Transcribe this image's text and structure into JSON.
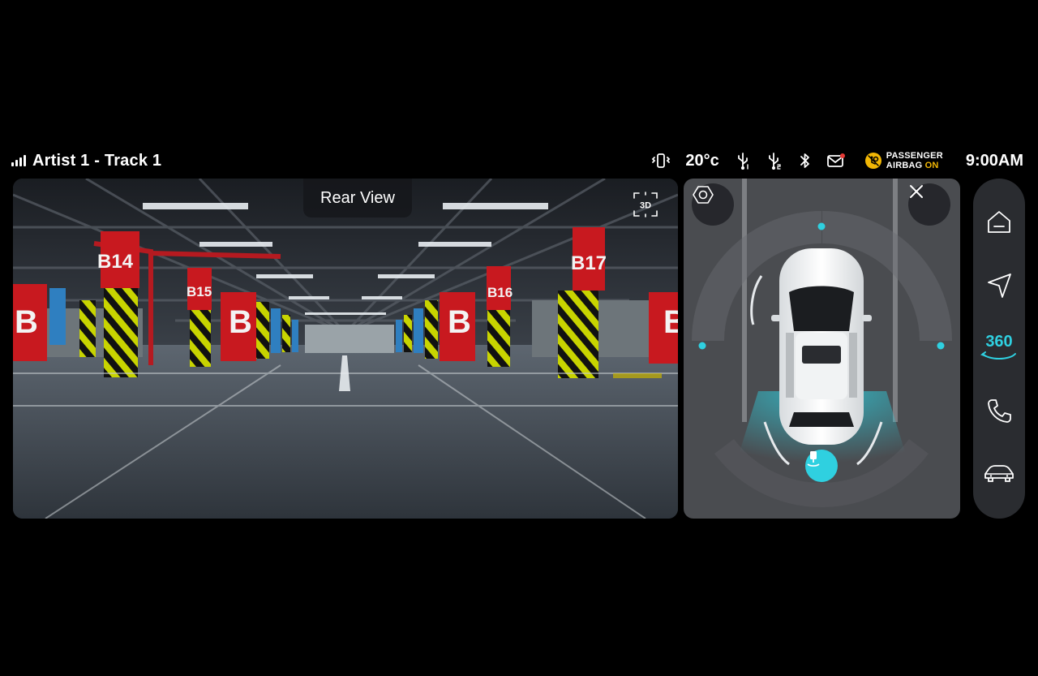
{
  "media": {
    "now_playing": "Artist 1 - Track 1"
  },
  "status": {
    "temperature": "20°c",
    "airbag_line1": "PASSENGER",
    "airbag_line2": "AIRBAG",
    "airbag_state": "ON",
    "clock": "9:00AM",
    "icons": [
      "vibrate-icon",
      "usb-1-icon",
      "usb-2-icon",
      "bluetooth-icon",
      "mail-icon",
      "airbag-off-icon"
    ]
  },
  "camera": {
    "view_label": "Rear View",
    "mode_3d_label": "3D",
    "pillar_labels": [
      "B14",
      "B15",
      "B16",
      "B17",
      "B",
      "B",
      "B",
      "B"
    ]
  },
  "surround": {
    "icons": [
      "settings-hex-icon",
      "close-icon",
      "parking-sensor-icon"
    ]
  },
  "dock": {
    "items": [
      "home-icon",
      "navigation-icon",
      "360-view",
      "phone-icon",
      "car-icon"
    ],
    "label_360": "360"
  },
  "colors": {
    "accent": "#2fd0e0",
    "airbag": "#f2b705",
    "pillar_red": "#c8191f",
    "hazard_yellow": "#c8d400",
    "notification_dot": "#e53935"
  }
}
